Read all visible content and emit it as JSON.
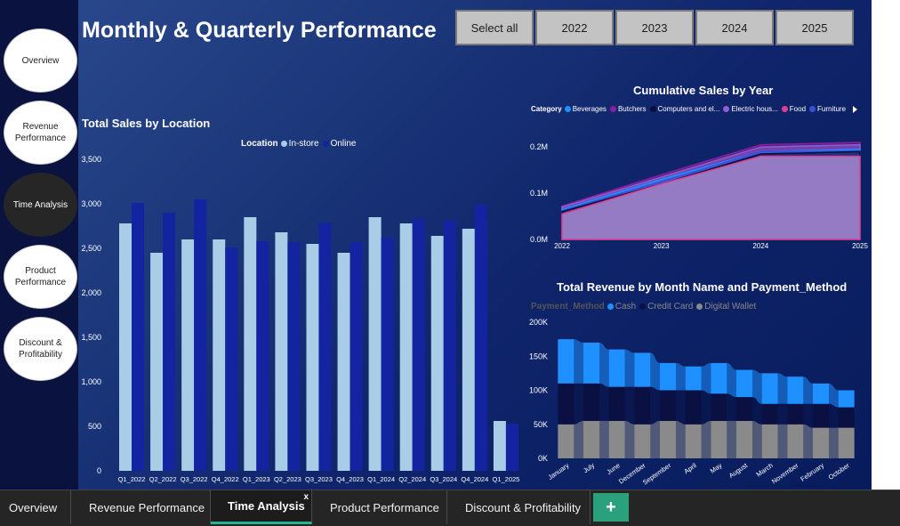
{
  "page": {
    "title": "Monthly & Quarterly Performance"
  },
  "nav": [
    {
      "label": "Overview",
      "active": false
    },
    {
      "label": "Revenue Performance",
      "active": false
    },
    {
      "label": "Time Analysis",
      "active": true
    },
    {
      "label": "Product Performance",
      "active": false
    },
    {
      "label": "Discount & Profitability",
      "active": false
    }
  ],
  "slicer": {
    "buttons": [
      "Select all",
      "2022",
      "2023",
      "2024",
      "2025"
    ]
  },
  "charts": {
    "sales_location": {
      "title": "Total Sales by Location",
      "legend_title": "Location",
      "legend": [
        {
          "label": "In-store",
          "color": "#a9cde6"
        },
        {
          "label": "Online",
          "color": "#1424a0"
        }
      ]
    },
    "cumulative": {
      "title": "Cumulative Sales by Year",
      "legend_title": "Category",
      "legend": [
        {
          "label": "Beverages",
          "color": "#1e90ff"
        },
        {
          "label": "Butchers",
          "color": "#8a1e9e"
        },
        {
          "label": "Computers and el...",
          "color": "#0a0f3a"
        },
        {
          "label": "Electric hous...",
          "color": "#8e5fd0"
        },
        {
          "label": "Food",
          "color": "#e0418c"
        },
        {
          "label": "Furniture",
          "color": "#3a4fd8"
        }
      ],
      "more_icon": "chevron-right-icon"
    },
    "revenue_payment": {
      "title": "Total Revenue by Month Name and Payment_Method",
      "legend_title": "Payment_Method",
      "legend": [
        {
          "label": "Cash",
          "color": "#1e90ff"
        },
        {
          "label": "Credit Card",
          "color": "#0a1142"
        },
        {
          "label": "Digital Wallet",
          "color": "#8a8a8a"
        }
      ]
    }
  },
  "chart_data": [
    {
      "type": "bar",
      "title": "Total Sales by Location",
      "categories": [
        "Q1_2022",
        "Q2_2022",
        "Q3_2022",
        "Q4_2022",
        "Q1_2023",
        "Q2_2023",
        "Q3_2023",
        "Q4_2023",
        "Q1_2024",
        "Q2_2024",
        "Q3_2024",
        "Q4_2024",
        "Q1_2025"
      ],
      "series": [
        {
          "name": "In-store",
          "values": [
            2780,
            2450,
            2600,
            2600,
            2850,
            2680,
            2550,
            2450,
            2850,
            2780,
            2640,
            2720,
            560
          ]
        },
        {
          "name": "Online",
          "values": [
            3010,
            2900,
            3050,
            2510,
            2580,
            2570,
            2790,
            2570,
            2620,
            2830,
            2810,
            2990,
            530
          ]
        }
      ],
      "y_ticks": [
        "0",
        "500",
        "1,000",
        "1,500",
        "2,000",
        "2,500",
        "3,000",
        "3,500"
      ],
      "ylim": [
        0,
        3500
      ],
      "legend_position": "top-right"
    },
    {
      "type": "area",
      "title": "Cumulative Sales by Year",
      "x": [
        "2022",
        "2023",
        "2024",
        "2025"
      ],
      "series": [
        {
          "name": "Beverages",
          "values": [
            0.065,
            0.13,
            0.19,
            0.195
          ]
        },
        {
          "name": "Butchers",
          "values": [
            0.072,
            0.14,
            0.205,
            0.21
          ]
        },
        {
          "name": "Computers and el...",
          "values": [
            0.06,
            0.12,
            0.185,
            0.19
          ]
        },
        {
          "name": "Electric hous...",
          "values": [
            0.07,
            0.135,
            0.2,
            0.205
          ]
        },
        {
          "name": "Food",
          "values": [
            0.055,
            0.12,
            0.18,
            0.18
          ]
        },
        {
          "name": "Furniture",
          "values": [
            0.062,
            0.125,
            0.19,
            0.192
          ]
        }
      ],
      "y_ticks": [
        "0.0M",
        "0.1M",
        "0.2M"
      ],
      "ylim": [
        0,
        0.2
      ],
      "legend_position": "top"
    },
    {
      "type": "bar",
      "title": "Total Revenue by Month Name and Payment_Method",
      "stacked": true,
      "ribbon": true,
      "categories": [
        "January",
        "July",
        "June",
        "December",
        "September",
        "April",
        "May",
        "August",
        "March",
        "November",
        "February",
        "October"
      ],
      "series": [
        {
          "name": "Cash",
          "values": [
            65,
            60,
            55,
            50,
            40,
            35,
            45,
            40,
            45,
            40,
            30,
            25
          ]
        },
        {
          "name": "Credit Card",
          "values": [
            60,
            55,
            50,
            55,
            45,
            50,
            40,
            35,
            30,
            30,
            35,
            30
          ]
        },
        {
          "name": "Digital Wallet",
          "values": [
            50,
            55,
            55,
            50,
            55,
            50,
            55,
            55,
            50,
            50,
            45,
            45
          ]
        }
      ],
      "y_ticks": [
        "0K",
        "50K",
        "100K",
        "150K",
        "200K"
      ],
      "ylim": [
        0,
        200
      ],
      "legend_position": "top-left"
    }
  ],
  "tabs": [
    {
      "label": "Overview",
      "active": false
    },
    {
      "label": "Revenue Performance",
      "active": false
    },
    {
      "label": "Time Analysis",
      "active": true,
      "close": "x"
    },
    {
      "label": "Product Performance",
      "active": false
    },
    {
      "label": "Discount & Profitability",
      "active": false
    }
  ],
  "add_page": {
    "label": "+",
    "icon": "plus-icon"
  }
}
